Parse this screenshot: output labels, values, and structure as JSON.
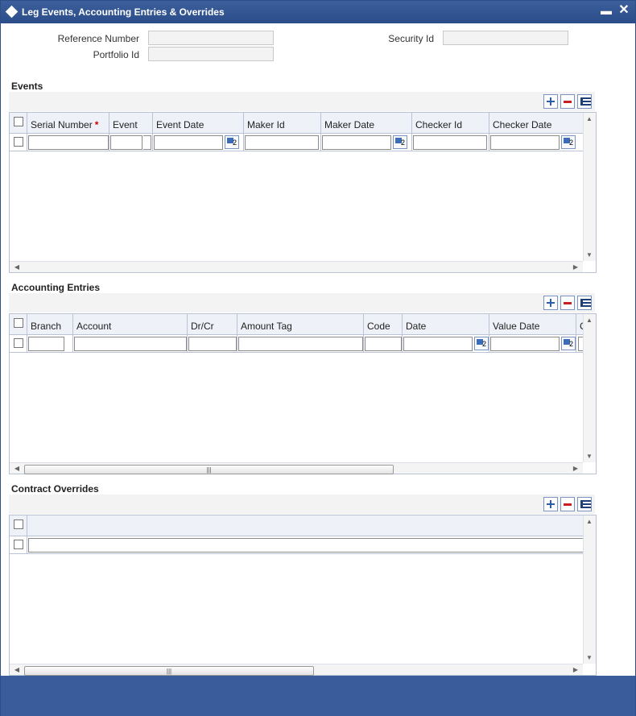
{
  "window": {
    "title": "Leg Events, Accounting Entries & Overrides",
    "minimize_glyph": "▬",
    "close_glyph": "✕"
  },
  "header_fields": {
    "reference_number_label": "Reference Number",
    "reference_number_value": "",
    "portfolio_id_label": "Portfolio Id",
    "portfolio_id_value": "",
    "security_id_label": "Security Id",
    "security_id_value": ""
  },
  "events": {
    "title": "Events",
    "columns": [
      "Serial Number",
      "Event",
      "Event Date",
      "Maker Id",
      "Maker Date",
      "Checker Id",
      "Checker Date"
    ],
    "required_marker": "*"
  },
  "accounting_entries": {
    "title": "Accounting Entries",
    "columns": [
      "Branch",
      "Account",
      "Dr/Cr",
      "Amount Tag",
      "Code",
      "Date",
      "Value Date",
      "C"
    ]
  },
  "contract_overrides": {
    "title": "Contract Overrides"
  },
  "icons": {
    "add": "plus-icon",
    "delete": "minus-icon",
    "view": "list-icon",
    "calendar": "calendar-icon"
  },
  "scroll": {
    "up": "▲",
    "down": "▼",
    "left": "◀",
    "right": "▶",
    "grip": "|||"
  },
  "colors": {
    "titlebar": "#2a4c89",
    "footer": "#3b5c9a",
    "required": "#cc0000"
  }
}
